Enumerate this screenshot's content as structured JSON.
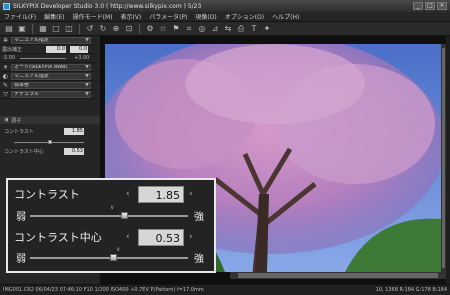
{
  "window": {
    "title": "SILKYPIX Developer Studio 3.0 ( http://www.silkypix.com )  5/23"
  },
  "menu": [
    "ファイル(F)",
    "編集(E)",
    "操作モード(M)",
    "表示(V)",
    "パラメータ(P)",
    "現像(D)",
    "オプション(O)",
    "ヘルプ(H)"
  ],
  "left_panel": {
    "preset": "マニュアル指定",
    "wb_label": "露出補正",
    "wb_value": "0.0",
    "range_min": "-3.00",
    "range_max": "+3.00",
    "exposure_value": "0.0",
    "wb_mode": "オート(SILKYPIX AWB)",
    "tone_mode": "マニュアル指定",
    "color_mode": "標準色",
    "sharp_mode": "ナチュラル",
    "section_title": "調子",
    "contrast_label": "コントラスト",
    "contrast_value": "1.85",
    "contrast_mid_label": "コントラスト中心",
    "contrast_mid_value": "0.53"
  },
  "zoom_panel": {
    "contrast_label": "コントラスト",
    "contrast_value": "1.85",
    "contrast_level": 0.6,
    "weak": "弱",
    "strong": "強",
    "contrast_mid_label": "コントラスト中心",
    "contrast_mid_value": "0.53",
    "contrast_mid_level": 0.53
  },
  "status": {
    "left": "IMG001.CR2 06/04/23 07:46:10 F10  1/200 ISO400 +0.7EV P(Pattern) f=17.0mm",
    "right": "10, 1368 R:184 G:178 B:184"
  },
  "icons": [
    "app-icon",
    "open-icon",
    "save-icon",
    "rotate-left-icon",
    "rotate-right-icon",
    "zoom-icon",
    "grid-icon",
    "develop-icon",
    "settings-icon"
  ]
}
